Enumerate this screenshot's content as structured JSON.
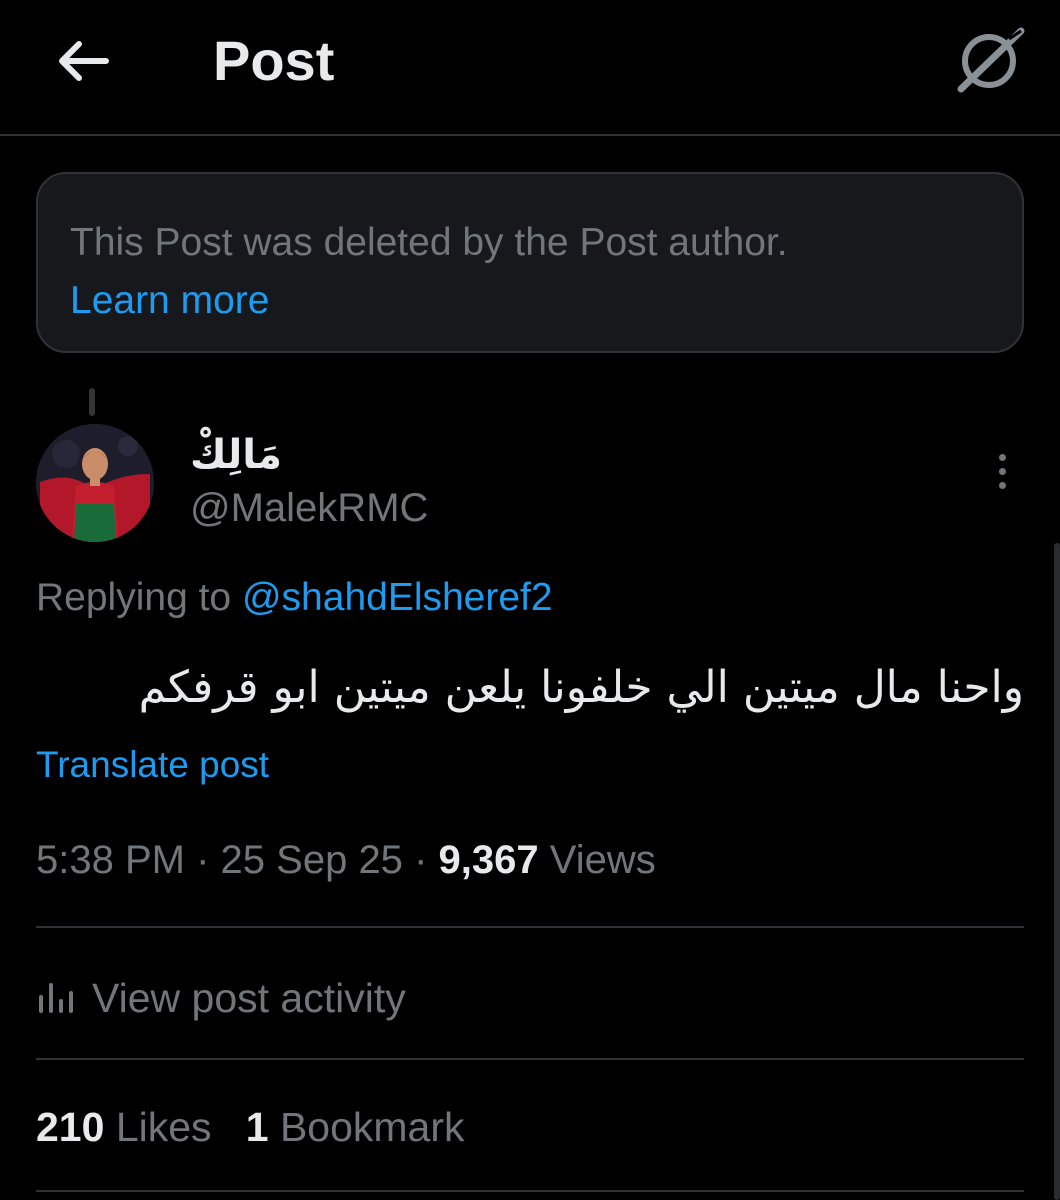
{
  "header": {
    "back_icon": "arrow-left-icon",
    "title": "Post",
    "grok_icon": "grok-icon"
  },
  "deleted_notice": {
    "text": "This Post was deleted by the Post author.",
    "link": "Learn more"
  },
  "post": {
    "author": {
      "display_name": "مَالِكْ",
      "handle": "@MalekRMC"
    },
    "more_icon": "more-vertical-icon",
    "replying_prefix": "Replying to",
    "replying_to": "@shahdElsheref2",
    "text": "واحنا مال ميتين الي خلفونا يلعن ميتين ابو قرفكم",
    "translate": "Translate post",
    "time": "5:38 PM",
    "sep1": "·",
    "date": "25 Sep 25",
    "sep2": "·",
    "views_count": "9,367",
    "views_label": "Views"
  },
  "activity": {
    "icon": "analytics-bars-icon",
    "label": "View post activity"
  },
  "stats": {
    "likes_count": "210",
    "likes_label": "Likes",
    "bookmarks_count": "1",
    "bookmarks_label": "Bookmark"
  },
  "colors": {
    "background": "#000000",
    "text_primary": "#e7e9ea",
    "text_secondary": "#71767b",
    "accent": "#1d9bf0",
    "border": "#2f3336"
  }
}
